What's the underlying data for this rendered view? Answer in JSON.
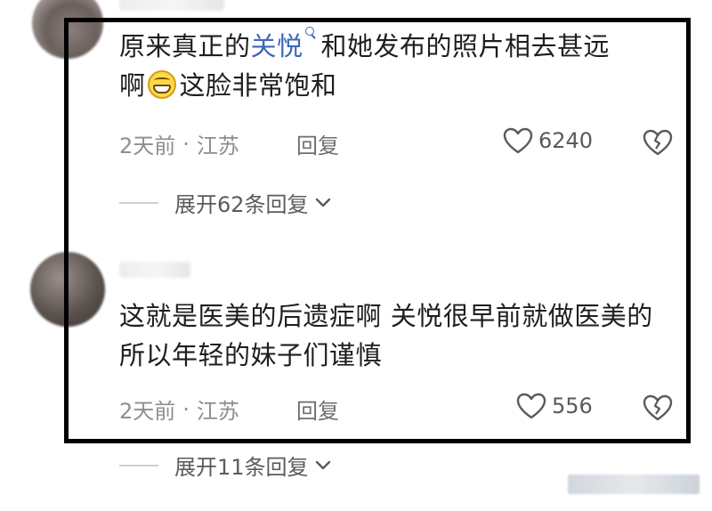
{
  "comments": [
    {
      "text_before_link": "原来真正的",
      "link_text": "关悦",
      "text_after_link": "和她发布的照片相去甚远",
      "text_line2_pre": "啊",
      "emoji": "grinning-face-icon",
      "text_line2_post": "这脸非常饱和",
      "time": "2天前",
      "separator": "·",
      "location": "江苏",
      "reply_label": "回复",
      "likes": "6240",
      "expand_label": "展开62条回复"
    },
    {
      "text": "这就是医美的后遗症啊 关悦很早前就做医美的 所以年轻的妹子们谨慎",
      "time": "2天前",
      "separator": "·",
      "location": "江苏",
      "reply_label": "回复",
      "likes": "556",
      "expand_label": "展开11条回复"
    }
  ],
  "colors": {
    "link": "#3d66b8",
    "frame": "#000000",
    "meta": "#8e8e8e"
  }
}
